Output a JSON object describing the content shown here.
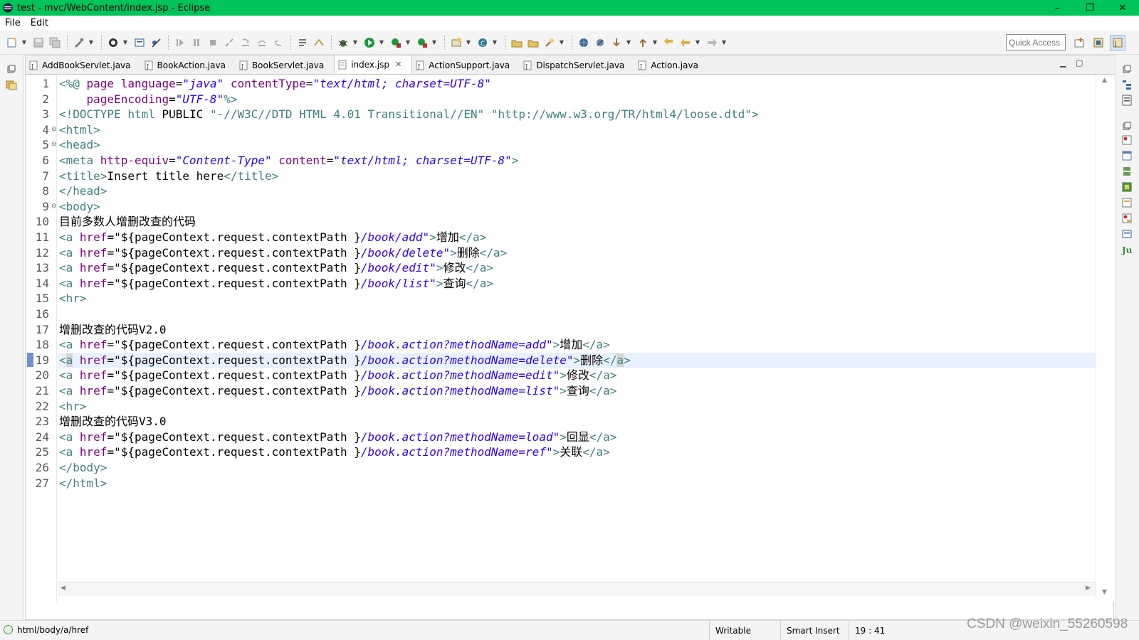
{
  "window": {
    "title": "test - mvc/WebContent/index.jsp - Eclipse",
    "minimize": "–",
    "maximize": "❐",
    "close": "✕"
  },
  "menu": [
    {
      "label": "File"
    },
    {
      "label": "Edit"
    }
  ],
  "toolbar": {
    "quick_access": "Quick Access"
  },
  "tabs": [
    {
      "label": "AddBookServlet.java",
      "active": false
    },
    {
      "label": "BookAction.java",
      "active": false
    },
    {
      "label": "BookServlet.java",
      "active": false
    },
    {
      "label": "index.jsp",
      "active": true
    },
    {
      "label": "ActionSupport.java",
      "active": false
    },
    {
      "label": "DispatchServlet.java",
      "active": false
    },
    {
      "label": "Action.java",
      "active": false
    }
  ],
  "editor": {
    "current_line": 19,
    "lines": [
      {
        "n": "1",
        "tokens": [
          [
            "tag",
            "<%@ "
          ],
          [
            "attr",
            "page "
          ],
          [
            "attr",
            "language"
          ],
          [
            "el",
            "="
          ],
          [
            "val",
            "\"java\""
          ],
          [
            "el",
            " "
          ],
          [
            "attr",
            "contentType"
          ],
          [
            "el",
            "="
          ],
          [
            "val",
            "\"text/html; charset=UTF-8\""
          ]
        ]
      },
      {
        "n": "2",
        "tokens": [
          [
            "el",
            "    "
          ],
          [
            "attr",
            "pageEncoding"
          ],
          [
            "el",
            "="
          ],
          [
            "val",
            "\"UTF-8\""
          ],
          [
            "tag",
            "%>"
          ]
        ]
      },
      {
        "n": "3",
        "tokens": [
          [
            "tag",
            "<!DOCTYPE "
          ],
          [
            "tag",
            "html "
          ],
          [
            "el",
            "PUBLIC "
          ],
          [
            "tag",
            "\"-//W3C//DTD HTML 4.01 Transitional//EN\" "
          ],
          [
            "tag",
            "\"http://www.w3.org/TR/html4/loose.dtd\""
          ],
          [
            "tag",
            ">"
          ]
        ]
      },
      {
        "n": "4",
        "fold": true,
        "tokens": [
          [
            "tag",
            "<html>"
          ]
        ]
      },
      {
        "n": "5",
        "fold": true,
        "tokens": [
          [
            "tag",
            "<head>"
          ]
        ]
      },
      {
        "n": "6",
        "tokens": [
          [
            "tag",
            "<meta "
          ],
          [
            "attr",
            "http-equiv"
          ],
          [
            "el",
            "="
          ],
          [
            "val",
            "\"Content-Type\""
          ],
          [
            "el",
            " "
          ],
          [
            "attr",
            "content"
          ],
          [
            "el",
            "="
          ],
          [
            "val",
            "\"text/html; charset=UTF-8\""
          ],
          [
            "tag",
            ">"
          ]
        ]
      },
      {
        "n": "7",
        "tokens": [
          [
            "tag",
            "<title>"
          ],
          [
            "text",
            "Insert title here"
          ],
          [
            "tag",
            "</title>"
          ]
        ]
      },
      {
        "n": "8",
        "tokens": [
          [
            "tag",
            "</head>"
          ]
        ]
      },
      {
        "n": "9",
        "fold": true,
        "tokens": [
          [
            "tag",
            "<body>"
          ]
        ]
      },
      {
        "n": "10",
        "tokens": [
          [
            "text",
            "目前多数人增删改查的代码"
          ]
        ]
      },
      {
        "n": "11",
        "tokens": [
          [
            "tag",
            "<a "
          ],
          [
            "attr",
            "href"
          ],
          [
            "el",
            "="
          ],
          [
            "text",
            "\"${pageContext.request.contextPath }"
          ],
          [
            "val",
            "/book/add\""
          ],
          [
            "tag",
            ">"
          ],
          [
            "text",
            "增加"
          ],
          [
            "tag",
            "</a>"
          ]
        ]
      },
      {
        "n": "12",
        "tokens": [
          [
            "tag",
            "<a "
          ],
          [
            "attr",
            "href"
          ],
          [
            "el",
            "="
          ],
          [
            "text",
            "\"${pageContext.request.contextPath }"
          ],
          [
            "val",
            "/book/delete\""
          ],
          [
            "tag",
            ">"
          ],
          [
            "text",
            "删除"
          ],
          [
            "tag",
            "</a>"
          ]
        ]
      },
      {
        "n": "13",
        "tokens": [
          [
            "tag",
            "<a "
          ],
          [
            "attr",
            "href"
          ],
          [
            "el",
            "="
          ],
          [
            "text",
            "\"${pageContext.request.contextPath }"
          ],
          [
            "val",
            "/book/edit\""
          ],
          [
            "tag",
            ">"
          ],
          [
            "text",
            "修改"
          ],
          [
            "tag",
            "</a>"
          ]
        ]
      },
      {
        "n": "14",
        "tokens": [
          [
            "tag",
            "<a "
          ],
          [
            "attr",
            "href"
          ],
          [
            "el",
            "="
          ],
          [
            "text",
            "\"${pageContext.request.contextPath }"
          ],
          [
            "val",
            "/book/list\""
          ],
          [
            "tag",
            ">"
          ],
          [
            "text",
            "查询"
          ],
          [
            "tag",
            "</a>"
          ]
        ]
      },
      {
        "n": "15",
        "tokens": [
          [
            "tag",
            "<hr>"
          ]
        ]
      },
      {
        "n": "16",
        "tokens": []
      },
      {
        "n": "17",
        "tokens": [
          [
            "text",
            "增删改查的代码V2.0"
          ]
        ]
      },
      {
        "n": "18",
        "tokens": [
          [
            "tag",
            "<a "
          ],
          [
            "attr",
            "href"
          ],
          [
            "el",
            "="
          ],
          [
            "text",
            "\"${pageContext.request.contextPath }"
          ],
          [
            "val",
            "/book.action?methodName=add\""
          ],
          [
            "tag",
            ">"
          ],
          [
            "text",
            "增加"
          ],
          [
            "tag",
            "</a>"
          ]
        ]
      },
      {
        "n": "19",
        "tokens": [
          [
            "tag",
            "<"
          ],
          [
            "mark",
            "a"
          ],
          [
            "el",
            " "
          ],
          [
            "attr",
            "href"
          ],
          [
            "el",
            "="
          ],
          [
            "text",
            "\"${pageContext.request.contextPath }"
          ],
          [
            "val",
            "/book.action?methodName=delete\""
          ],
          [
            "tag",
            ">"
          ],
          [
            "text",
            "删除"
          ],
          [
            "tag",
            "</"
          ],
          [
            "mark",
            "a"
          ],
          [
            "tag",
            ">"
          ]
        ]
      },
      {
        "n": "20",
        "tokens": [
          [
            "tag",
            "<a "
          ],
          [
            "attr",
            "href"
          ],
          [
            "el",
            "="
          ],
          [
            "text",
            "\"${pageContext.request.contextPath }"
          ],
          [
            "val",
            "/book.action?methodName=edit\""
          ],
          [
            "tag",
            ">"
          ],
          [
            "text",
            "修改"
          ],
          [
            "tag",
            "</a>"
          ]
        ]
      },
      {
        "n": "21",
        "tokens": [
          [
            "tag",
            "<a "
          ],
          [
            "attr",
            "href"
          ],
          [
            "el",
            "="
          ],
          [
            "text",
            "\"${pageContext.request.contextPath }"
          ],
          [
            "val",
            "/book.action?methodName=list\""
          ],
          [
            "tag",
            ">"
          ],
          [
            "text",
            "查询"
          ],
          [
            "tag",
            "</a>"
          ]
        ]
      },
      {
        "n": "22",
        "tokens": [
          [
            "tag",
            "<hr>"
          ]
        ]
      },
      {
        "n": "23",
        "tokens": [
          [
            "text",
            "增删改查的代码V3.0"
          ]
        ]
      },
      {
        "n": "24",
        "tokens": [
          [
            "tag",
            "<a "
          ],
          [
            "attr",
            "href"
          ],
          [
            "el",
            "="
          ],
          [
            "text",
            "\"${pageContext.request.contextPath }"
          ],
          [
            "val",
            "/book.action?methodName=load\""
          ],
          [
            "tag",
            ">"
          ],
          [
            "text",
            "回显"
          ],
          [
            "tag",
            "</a>"
          ]
        ]
      },
      {
        "n": "25",
        "tokens": [
          [
            "tag",
            "<a "
          ],
          [
            "attr",
            "href"
          ],
          [
            "el",
            "="
          ],
          [
            "text",
            "\"${pageContext.request.contextPath }"
          ],
          [
            "val",
            "/book.action?methodName=ref\""
          ],
          [
            "tag",
            ">"
          ],
          [
            "text",
            "关联"
          ],
          [
            "tag",
            "</a>"
          ]
        ]
      },
      {
        "n": "26",
        "tokens": [
          [
            "tag",
            "</body>"
          ]
        ]
      },
      {
        "n": "27",
        "tokens": [
          [
            "tag",
            "</html>"
          ]
        ]
      }
    ]
  },
  "status": {
    "path": "html/body/a/href",
    "writable": "Writable",
    "insert_mode": "Smart Insert",
    "position": "19 : 41"
  },
  "watermark": "CSDN @weixin_55260598",
  "colors": {
    "titlebar": "#00c35a",
    "tag": "#3f7f7f",
    "attribute": "#7f007f",
    "value": "#2a00ff",
    "current_line": "#e8f2fe"
  }
}
